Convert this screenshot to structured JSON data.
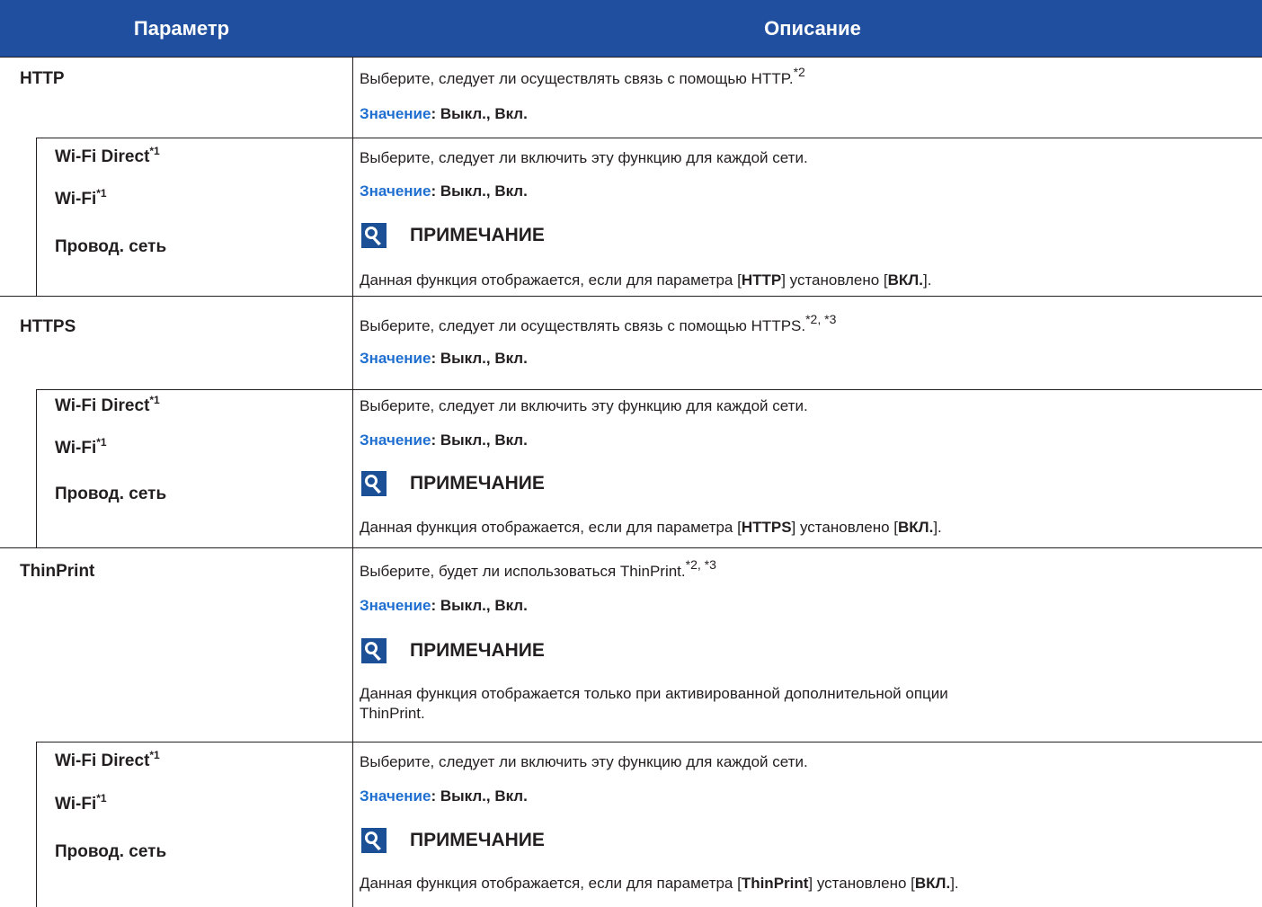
{
  "header": {
    "param": "Параметр",
    "desc": "Описание"
  },
  "value_key": "Значение",
  "value_text": ": Выкл., Вкл.",
  "note_title": "ПРИМЕЧАНИЕ",
  "sub_items": {
    "wifi_direct": "Wi-Fi Direct",
    "wifi": "Wi-Fi",
    "wired": "Провод. сеть",
    "sup1": "*1"
  },
  "sections": {
    "http": {
      "name": "HTTP",
      "desc": "Выберите, следует ли осуществлять связь с помощью HTTP.",
      "sup": "*2",
      "sub_desc": "Выберите, следует ли включить эту функцию для каждой сети.",
      "note_pre": "Данная функция отображается, если для параметра [",
      "note_b1": "HTTP",
      "note_mid": "] установлено [",
      "note_b2": "ВКЛ.",
      "note_end": "]."
    },
    "https": {
      "name": "HTTPS",
      "desc": "Выберите, следует ли осуществлять связь с помощью HTTPS.",
      "sup": "*2, *3",
      "sub_desc": "Выберите, следует ли включить эту функцию для каждой сети.",
      "note_pre": "Данная функция отображается, если для параметра [",
      "note_b1": "HTTPS",
      "note_mid": "] установлено [",
      "note_b2": "ВКЛ.",
      "note_end": "]."
    },
    "thinprint": {
      "name": "ThinPrint",
      "desc": "Выберите, будет ли использоваться ThinPrint.",
      "sup": "*2, *3",
      "main_note": "Данная функция отображается только при активированной дополнительной опции ThinPrint.",
      "sub_desc": "Выберите, следует ли включить эту функцию для каждой сети.",
      "note_pre": "Данная функция отображается, если для параметра [",
      "note_b1": "ThinPrint",
      "note_mid": "] установлено [",
      "note_b2": "ВКЛ.",
      "note_end": "]."
    }
  }
}
